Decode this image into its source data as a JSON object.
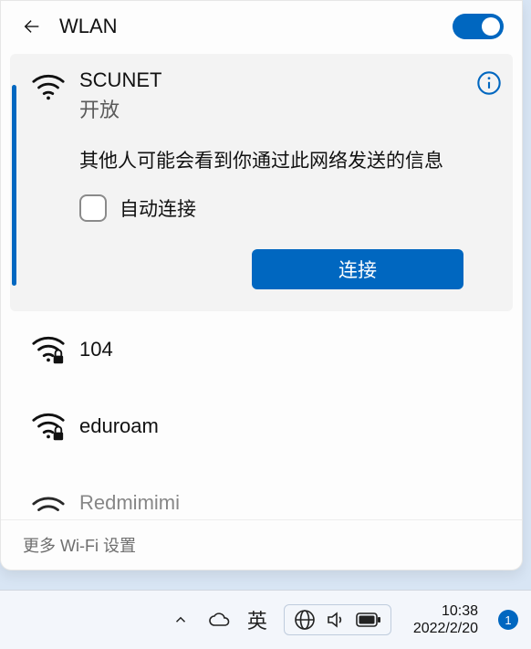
{
  "header": {
    "title": "WLAN",
    "toggle_on": true
  },
  "selected_network": {
    "name": "SCUNET",
    "subtitle": "开放",
    "security": "open",
    "warning": "其他人可能会看到你通过此网络发送的信息",
    "auto_connect_label": "自动连接",
    "auto_connect_checked": false,
    "connect_label": "连接"
  },
  "other_networks": [
    {
      "name": "104",
      "secured": true
    },
    {
      "name": "eduroam",
      "secured": true
    },
    {
      "name": "Redmimimi",
      "secured": false
    }
  ],
  "footer": {
    "more_settings": "更多 Wi-Fi 设置"
  },
  "taskbar": {
    "ime": "英",
    "time": "10:38",
    "date": "2022/2/20",
    "notification_count": "1"
  },
  "colors": {
    "accent": "#0067c0"
  }
}
